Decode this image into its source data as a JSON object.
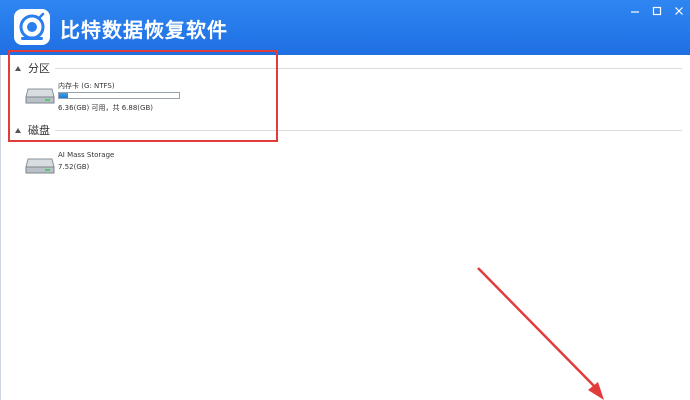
{
  "app": {
    "title": "比特数据恢复软件",
    "logo_icon": "disk-recovery-logo-icon",
    "titlebar_color": "#2a7fef"
  },
  "window_controls": {
    "minimize_icon": "minimize-icon",
    "maximize_icon": "maximize-icon",
    "close_icon": "close-icon"
  },
  "sections": {
    "partitions": {
      "label": "分区",
      "items": [
        {
          "name": "内存卡 (G: NTFS)",
          "size_text": "6.36(GB) 可用，共 6.88(GB)",
          "usage_fraction": 0.076,
          "icon": "hard-drive-icon"
        }
      ]
    },
    "disks": {
      "label": "磁盘",
      "items": [
        {
          "name": "AI Mass Storage",
          "size_text": "7.52(GB)",
          "icon": "hard-drive-icon"
        }
      ]
    }
  },
  "annotation": {
    "highlight_color": "#e23b3b"
  }
}
